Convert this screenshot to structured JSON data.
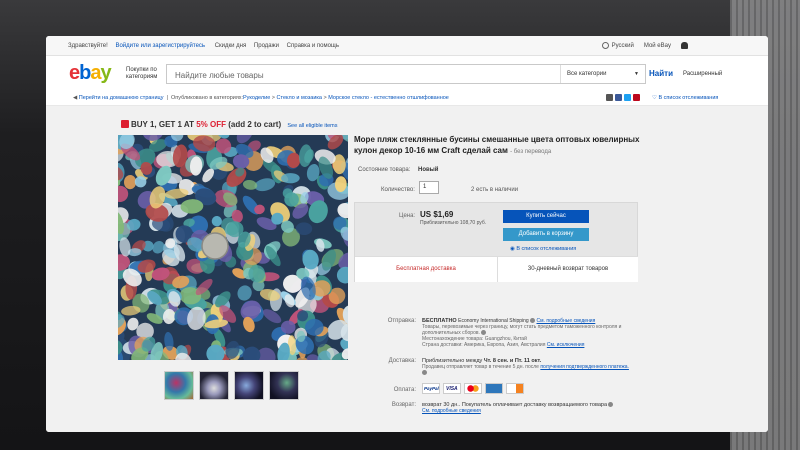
{
  "topbar": {
    "greeting": "Здравствуйте!",
    "login": "Войдите или зарегистрируйтесь",
    "links": [
      "Скидки дня",
      "Продажи",
      "Справка и помощь"
    ],
    "language": "Русский",
    "my_ebay": "Мой eBay"
  },
  "header": {
    "logo": [
      "e",
      "b",
      "a",
      "y"
    ],
    "shop_by": "Покупки по категориям",
    "search_placeholder": "Найдите любые товары",
    "category": "Все категории",
    "find": "Найти",
    "advanced": "Расширенный"
  },
  "crumbs": {
    "back": "Перейти на домашнюю страницу",
    "published": "Опубликовано в категориях:",
    "path": [
      "Рукоделие",
      "Стекло и мозаика",
      "Морское стекло - естественно отшлифованное"
    ],
    "watch": "В список отслеживания"
  },
  "promo": {
    "text": "BUY 1, GET 1 AT",
    "percent": "5% OFF",
    "rest": "(add 2 to cart)",
    "link": "See all eligible items"
  },
  "item": {
    "title": "Море пляж стеклянные бусины смешанные цвета оптовых ювелирных кулон декор 10-16 мм Craft сделай сам",
    "no_translation": "- без перевода",
    "condition_label": "Состояние товара:",
    "condition": "Новый",
    "quantity_label": "Количество:",
    "quantity": "1",
    "available": "2 есть в наличии"
  },
  "pricebox": {
    "price_label": "Цена:",
    "price": "US $1,69",
    "approx": "Приблизительно 108,70 руб.",
    "buy_now": "Купить сейчас",
    "add_cart": "Добавить в корзину",
    "watch": "В список отслеживания",
    "free_shipping": "Бесплатная доставка",
    "returns": "30-дневный возврат товаров"
  },
  "shipping": {
    "label": "Отправка:",
    "free": "БЕСПЛАТНО",
    "method": "Economy International Shipping",
    "details_link": "См. подробные сведения",
    "note": "Товары, перевозимые через границу, могут стать предметом таможенного контроля и дополнительных сборов.",
    "location": "Местонахождение товара: Guangzhou, Китай",
    "ships_to": "Страна доставки: Америка, Европа, Азия, Австралия",
    "exclusions": "См. исключения"
  },
  "delivery": {
    "label": "Доставка:",
    "est": "Приблизительно между",
    "dates": "Чт. 8 сен. и Пт. 11 окт.",
    "note": "Продавец отправляет товар в течение 5 дн. после",
    "link": "получения подтвержденного платежа."
  },
  "payment": {
    "label": "Оплата:",
    "methods": [
      "PayPal",
      "VISA",
      "MasterCard",
      "AmEx",
      "Discover"
    ]
  },
  "returns": {
    "label": "Возврат:",
    "text": "возврат 30 дн.. Покупатель оплачивает доставку возвращаемого товара",
    "link": "См. подробные сведения"
  }
}
